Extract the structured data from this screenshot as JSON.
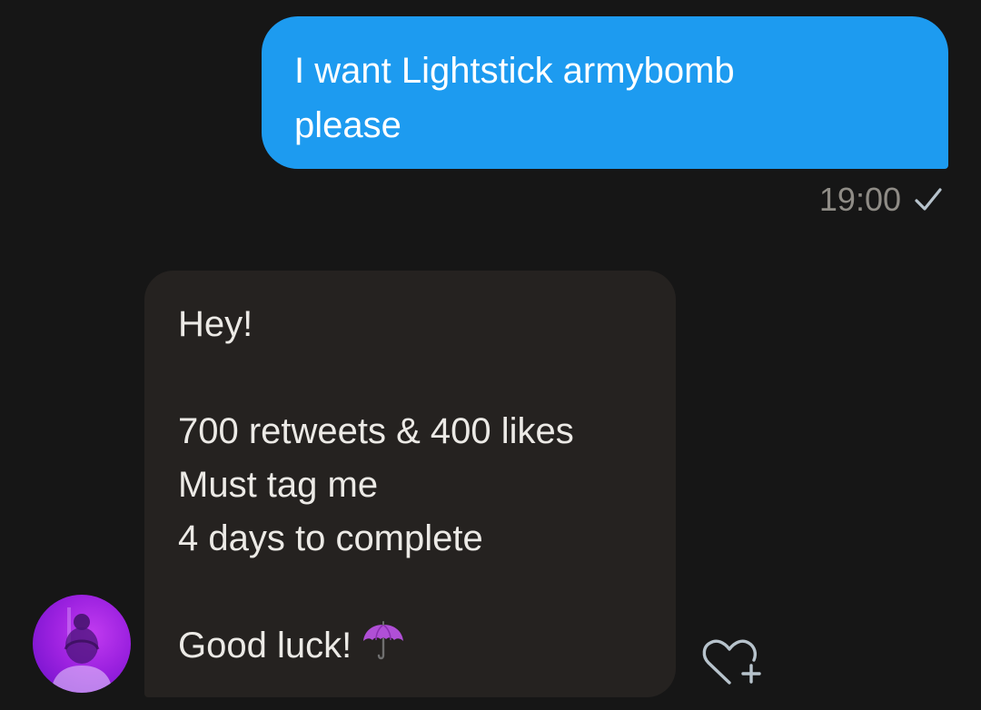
{
  "conversation": {
    "outgoing": {
      "text": "I want Lightstick armybomb\nplease",
      "time": "19:00",
      "status_icon": "check-icon"
    },
    "incoming": {
      "lines": [
        "Hey!",
        "",
        "700 retweets & 400 likes",
        "Must tag me",
        "4 days to complete",
        "",
        "Good luck!"
      ],
      "emoji": "umbrella-icon",
      "sender_avatar": "avatar"
    },
    "react_button_icon": "heart-plus-icon"
  },
  "colors": {
    "background": "#161616",
    "outgoing_bubble": "#1d9bf0",
    "incoming_bubble": "#252220",
    "timestamp": "#8f8c86",
    "emoji_umbrella": "#b04fd6"
  }
}
